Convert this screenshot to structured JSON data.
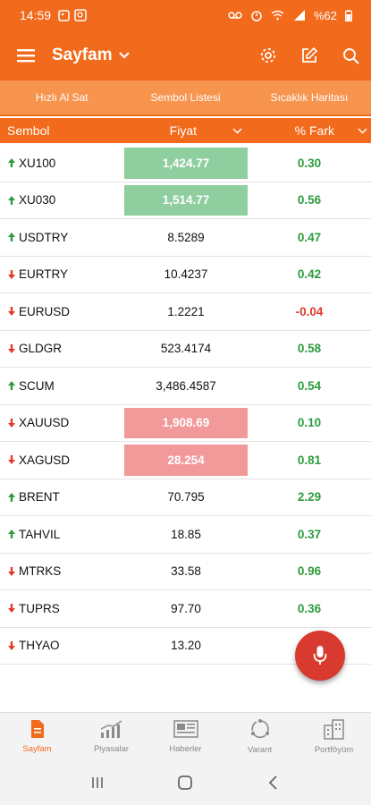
{
  "status_bar": {
    "time": "14:59",
    "battery": "%62"
  },
  "header": {
    "title": "Sayfam"
  },
  "subtabs": [
    "Hızlı Al Sat",
    "Sembol Listesi",
    "Sıcaklık Haritası"
  ],
  "columns": {
    "symbol": "Sembol",
    "price": "Fiyat",
    "diff": "% Fark"
  },
  "rows": [
    {
      "symbol": "XU100",
      "dir": "up",
      "price": "1,424.77",
      "diff": "0.30",
      "highlight": "up"
    },
    {
      "symbol": "XU030",
      "dir": "up",
      "price": "1,514.77",
      "diff": "0.56",
      "highlight": "up"
    },
    {
      "symbol": "USDTRY",
      "dir": "up",
      "price": "8.5289",
      "diff": "0.47",
      "highlight": ""
    },
    {
      "symbol": "EURTRY",
      "dir": "down",
      "price": "10.4237",
      "diff": "0.42",
      "highlight": ""
    },
    {
      "symbol": "EURUSD",
      "dir": "down",
      "price": "1.2221",
      "diff": "-0.04",
      "highlight": ""
    },
    {
      "symbol": "GLDGR",
      "dir": "down",
      "price": "523.4174",
      "diff": "0.58",
      "highlight": ""
    },
    {
      "symbol": "SCUM",
      "dir": "up",
      "price": "3,486.4587",
      "diff": "0.54",
      "highlight": ""
    },
    {
      "symbol": "XAUUSD",
      "dir": "down",
      "price": "1,908.69",
      "diff": "0.10",
      "highlight": "down"
    },
    {
      "symbol": "XAGUSD",
      "dir": "down",
      "price": "28.254",
      "diff": "0.81",
      "highlight": "down"
    },
    {
      "symbol": "BRENT",
      "dir": "up",
      "price": "70.795",
      "diff": "2.29",
      "highlight": ""
    },
    {
      "symbol": "TAHVIL",
      "dir": "up",
      "price": "18.85",
      "diff": "0.37",
      "highlight": ""
    },
    {
      "symbol": "MTRKS",
      "dir": "down",
      "price": "33.58",
      "diff": "0.96",
      "highlight": ""
    },
    {
      "symbol": "TUPRS",
      "dir": "down",
      "price": "97.70",
      "diff": "0.36",
      "highlight": ""
    },
    {
      "symbol": "THYAO",
      "dir": "down",
      "price": "13.20",
      "diff": "",
      "highlight": ""
    }
  ],
  "bottom_nav": [
    {
      "label": "Sayfam",
      "icon": "document-icon",
      "active": true
    },
    {
      "label": "Piyasalar",
      "icon": "bar-chart-icon",
      "active": false
    },
    {
      "label": "Haberler",
      "icon": "news-icon",
      "active": false
    },
    {
      "label": "Varant",
      "icon": "cycle-icon",
      "active": false
    },
    {
      "label": "Portföyüm",
      "icon": "buildings-icon",
      "active": false
    }
  ],
  "colors": {
    "brand": "#f26a1b",
    "subtab_bg": "#f7944e",
    "up_highlight": "#8fce9f",
    "down_highlight": "#f2999a",
    "positive": "#2e9c3e",
    "negative": "#e23a2a",
    "fab": "#d83a30"
  }
}
